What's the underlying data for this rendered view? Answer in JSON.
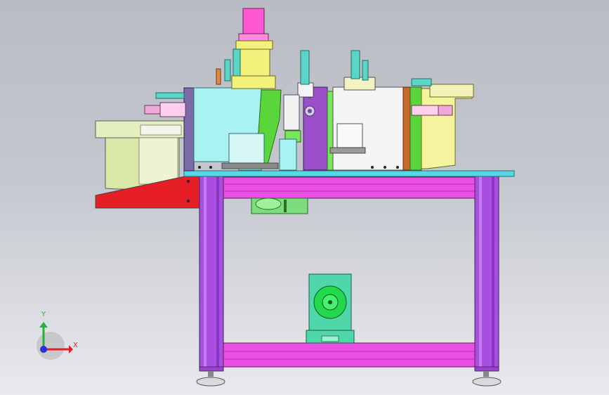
{
  "viewport": {
    "background_top": "#b9bcc4",
    "background_bottom": "#e9eaee"
  },
  "triad": {
    "x_label": "X",
    "y_label": "Y",
    "x_color": "#e0212b",
    "y_color": "#22b43a",
    "z_color": "#2433d8"
  },
  "palette": {
    "frame": "#b04ee0",
    "frame_cross": "#e84fe0",
    "table_top": "#58d8e6",
    "hopper_left": "#e0ecb8",
    "chute": "#e8202a",
    "press_body": "#a8f0f0",
    "press_body_right": "#f4f4f4",
    "cylinder": "#ff5cd0",
    "cylinder_block": "#f2f27a",
    "green_parts": "#5adc3a",
    "motor_mount": "#4ed6a8",
    "feeder_right": "#f4f4a0"
  }
}
